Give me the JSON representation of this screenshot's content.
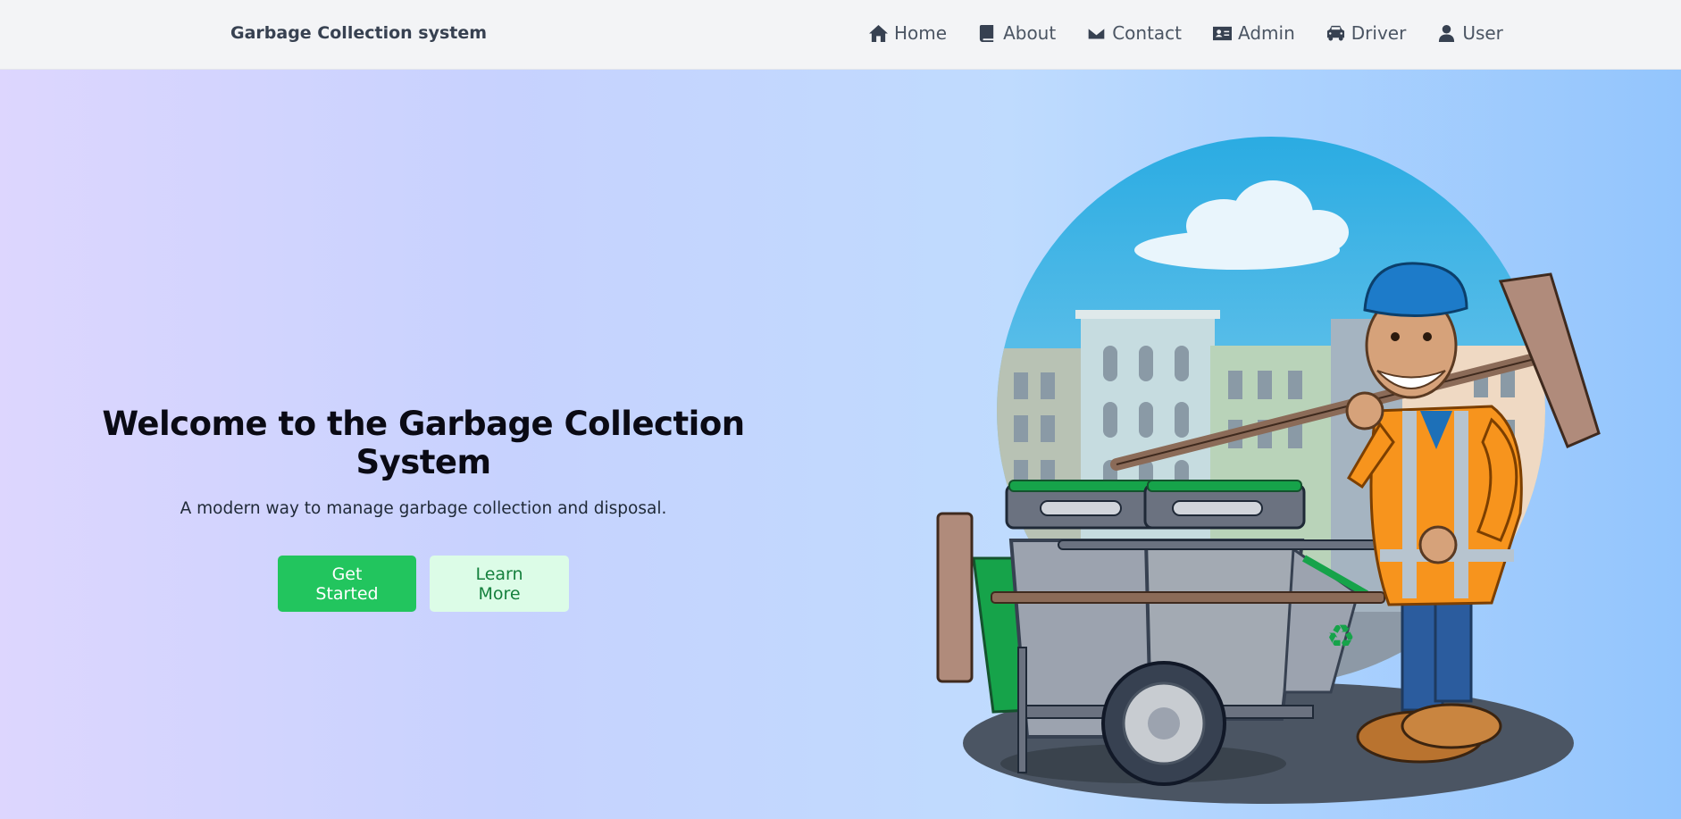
{
  "navbar": {
    "brand": "Garbage Collection system",
    "links": [
      {
        "label": "Home",
        "icon": "home-icon"
      },
      {
        "label": "About",
        "icon": "book-icon"
      },
      {
        "label": "Contact",
        "icon": "envelope-icon"
      },
      {
        "label": "Admin",
        "icon": "id-card-icon"
      },
      {
        "label": "Driver",
        "icon": "car-icon"
      },
      {
        "label": "User",
        "icon": "user-icon"
      }
    ]
  },
  "hero": {
    "title": "Welcome to the Garbage Collection System",
    "subtitle": "A modern way to manage garbage collection and disposal.",
    "primary_button": "Get Started",
    "secondary_button": "Learn More"
  },
  "colors": {
    "primary": "#22c55e",
    "secondary_bg": "#dcfce7",
    "secondary_text": "#15803d",
    "gradient_start": "#ddd6fe",
    "gradient_end": "#93c5fd"
  }
}
